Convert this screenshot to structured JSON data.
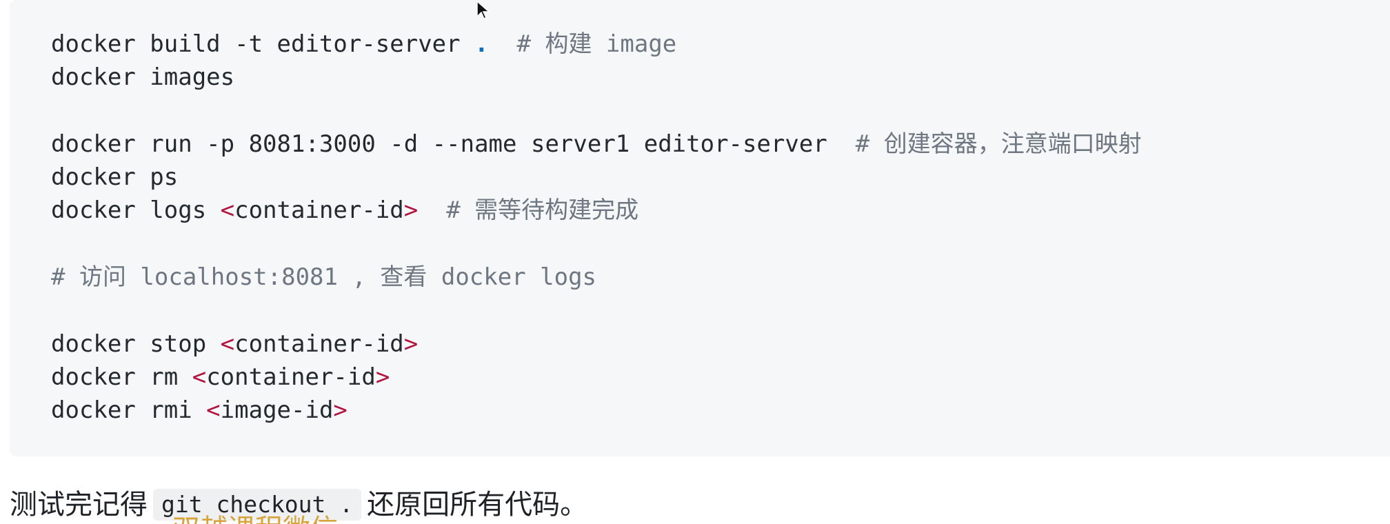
{
  "code_block": {
    "lines": [
      {
        "cmd": "docker build -t editor-server ",
        "dot": ".",
        "comment": "  # 构建 image"
      },
      {
        "cmd": "docker images"
      },
      {
        "blank": true
      },
      {
        "cmd": "docker run -p 8081:3000 -d --name server1 editor-server",
        "comment": "  # 创建容器，注意端口映射"
      },
      {
        "cmd": "docker ps"
      },
      {
        "cmd": "docker logs ",
        "arg": "container-id",
        "comment": "  # 需等待构建完成"
      },
      {
        "blank": true
      },
      {
        "comment_only": "# 访问 localhost:8081 , 查看 docker logs"
      },
      {
        "blank": true
      },
      {
        "cmd": "docker stop ",
        "arg": "container-id"
      },
      {
        "cmd": "docker rm ",
        "arg": "container-id"
      },
      {
        "cmd": "docker rmi ",
        "arg": "image-id"
      }
    ]
  },
  "prose": {
    "before": "测试完记得",
    "inline_code": "git checkout .",
    "after": "还原回所有代码。"
  },
  "overlay": {
    "text": "双越课程微信"
  },
  "colors": {
    "code_background": "#f6f7f9",
    "comment": "#6e7781",
    "angle_bracket": "#b3123c",
    "dot": "#0b6fbf",
    "overlay": "#d6a43a"
  },
  "icons": {
    "cursor": "mouse-pointer-icon"
  }
}
